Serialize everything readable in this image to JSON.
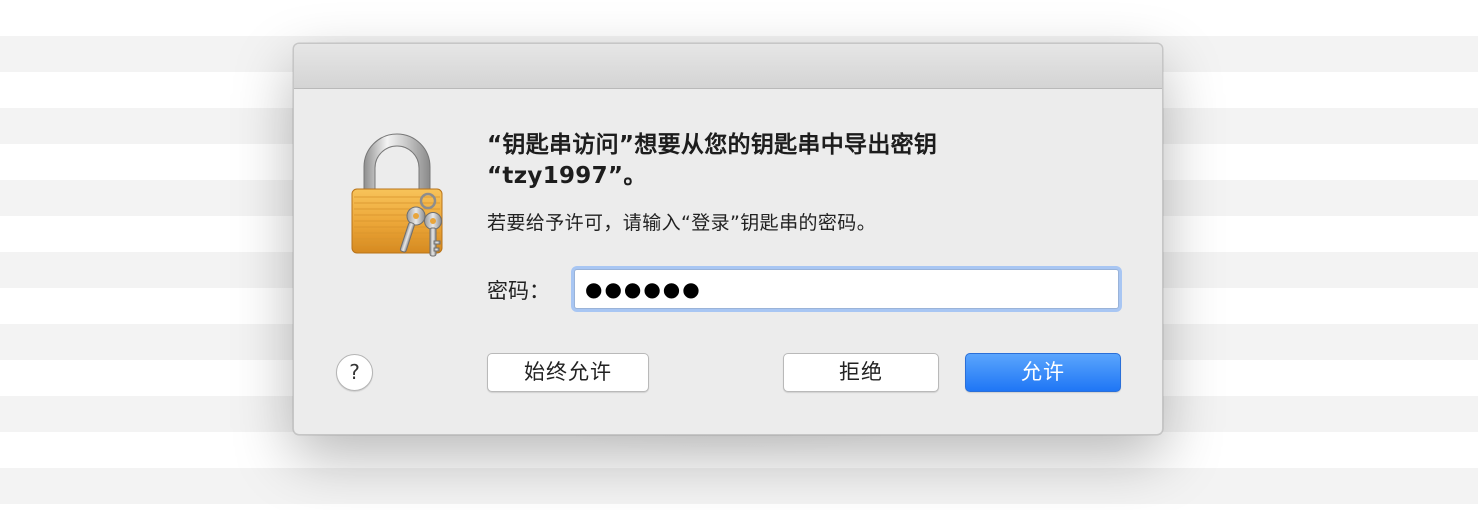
{
  "dialog": {
    "title_line1": "“钥匙串访问”想要从您的钥匙串中导出密钥",
    "title_line2": "“tzy1997”。",
    "message": "若要给予许可，请输入“登录”钥匙串的密码。",
    "password_label": "密码：",
    "password_value": "●●●●●●",
    "help_label": "?",
    "buttons": {
      "always_allow": "始终允许",
      "deny": "拒绝",
      "allow": "允许"
    },
    "icons": {
      "lock": "lock-with-keys-icon"
    },
    "colors": {
      "accent": "#1f76f5",
      "lock_body": "#f0a93a",
      "focus_ring": "#a8c6f3"
    }
  }
}
